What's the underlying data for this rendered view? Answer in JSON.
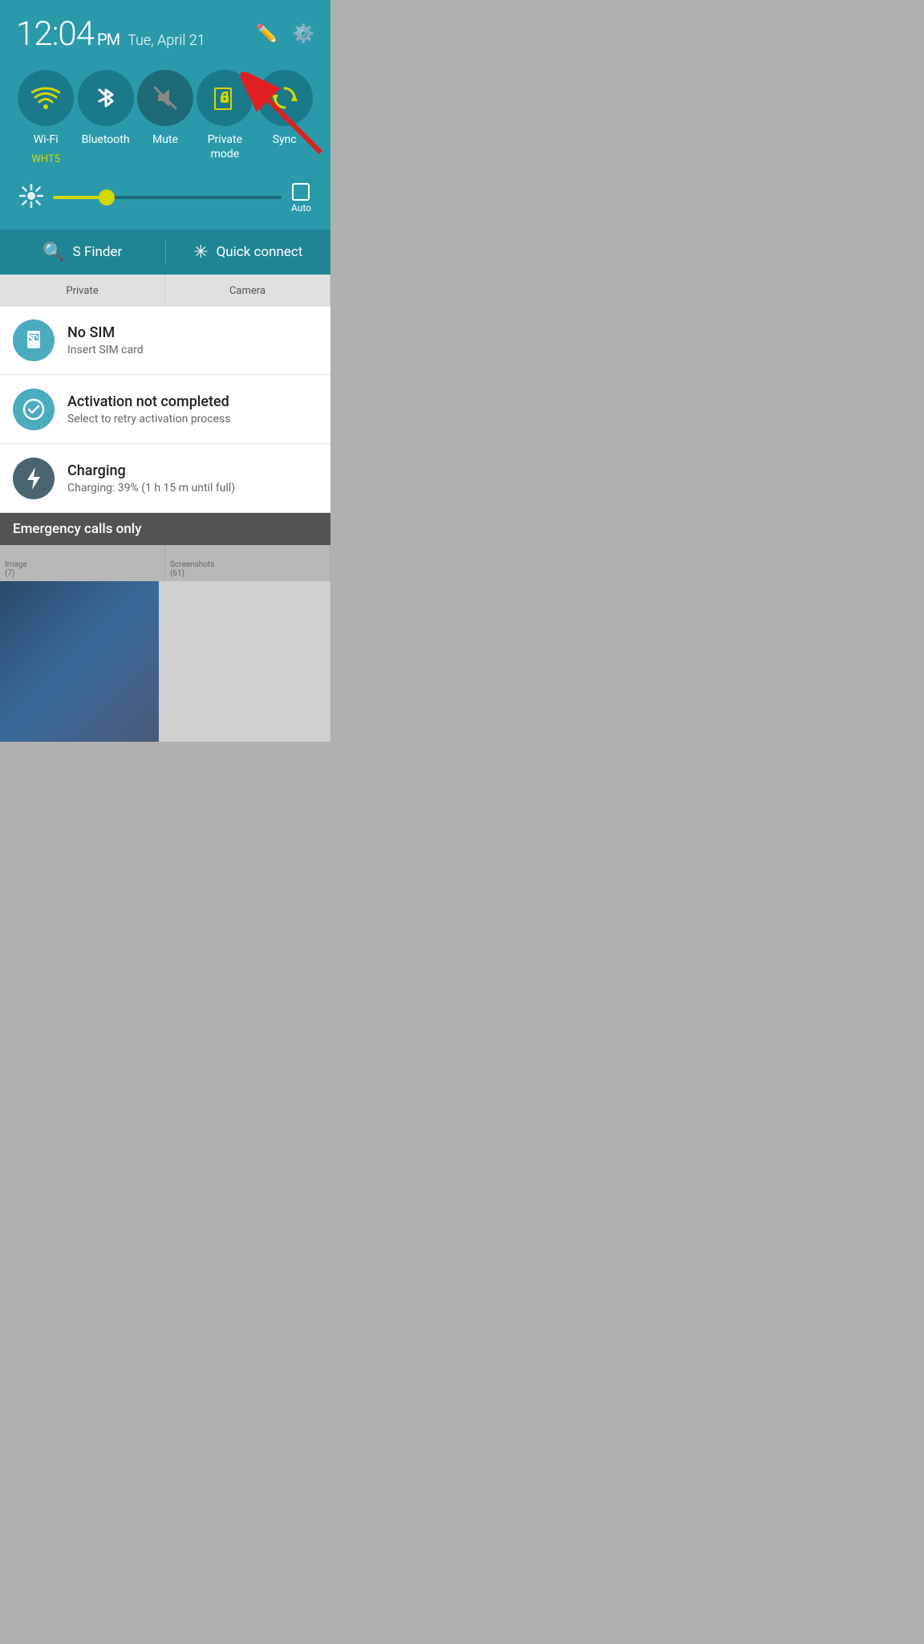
{
  "status": {
    "time": "12:04",
    "am_pm": "PM",
    "date": "Tue, April 21"
  },
  "toggles": [
    {
      "id": "wifi",
      "label": "Wi-Fi",
      "sublabel": "WHT5",
      "active": true
    },
    {
      "id": "bluetooth",
      "label": "Bluetooth",
      "sublabel": "",
      "active": true
    },
    {
      "id": "mute",
      "label": "Mute",
      "sublabel": "",
      "active": false
    },
    {
      "id": "private",
      "label": "Private\nmode",
      "sublabel": "",
      "active": true
    },
    {
      "id": "sync",
      "label": "Sync",
      "sublabel": "",
      "active": true
    }
  ],
  "brightness": {
    "value": 22,
    "auto_label": "Auto"
  },
  "finder_bar": {
    "sfinder_label": "S Finder",
    "quickconnect_label": "Quick connect"
  },
  "app_peek": [
    {
      "label": "Private"
    },
    {
      "label": "Camera"
    }
  ],
  "notifications": [
    {
      "id": "no-sim",
      "title": "No SIM",
      "subtitle": "Insert SIM card",
      "icon": "sim"
    },
    {
      "id": "activation",
      "title": "Activation not completed",
      "subtitle": "Select to retry activation process",
      "icon": "check"
    },
    {
      "id": "charging",
      "title": "Charging",
      "subtitle": "Charging: 39% (1 h 15 m until full)",
      "icon": "bolt"
    }
  ],
  "gallery_peek": [
    {
      "label": "Image",
      "count": "(7)"
    },
    {
      "label": "Screenshots",
      "count": "(61)"
    }
  ],
  "emergency_text": "Emergency calls only"
}
